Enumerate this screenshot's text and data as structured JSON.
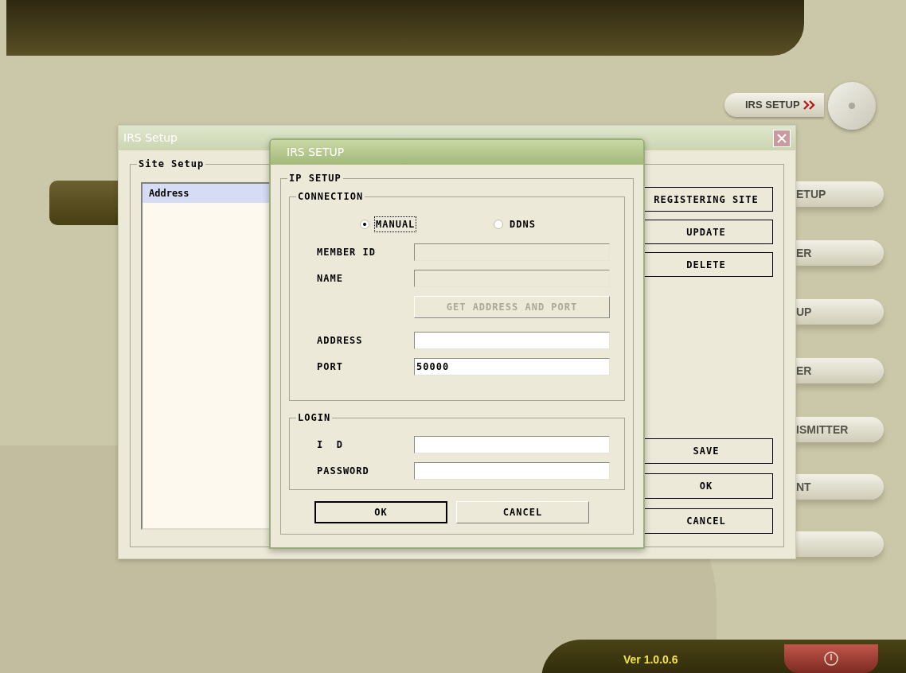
{
  "app": {
    "top_button": {
      "label": "IRS SETUP"
    },
    "side_menu": [
      {
        "label": "ETUP"
      },
      {
        "label": "ER"
      },
      {
        "label": "UP"
      },
      {
        "label": "ER"
      },
      {
        "label": "ISMITTER"
      },
      {
        "label": "NT"
      }
    ],
    "version": "Ver 1.0.0.6"
  },
  "site_dialog": {
    "title": "IRS Setup",
    "group": "Site Setup",
    "list": [
      {
        "label": "Address",
        "selected": true
      }
    ],
    "top_buttons": [
      {
        "label": "REGISTERING SITE"
      },
      {
        "label": "UPDATE"
      },
      {
        "label": "DELETE"
      }
    ],
    "bottom_buttons": [
      {
        "label": "SAVE"
      },
      {
        "label": "OK"
      },
      {
        "label": "CANCEL"
      }
    ]
  },
  "irs_dialog": {
    "title": "IRS SETUP",
    "group": "IP SETUP",
    "connection": {
      "title": "CONNECTION",
      "modes": [
        {
          "label": "MANUAL",
          "selected": true,
          "focused": true
        },
        {
          "label": "DDNS",
          "selected": false,
          "focused": false
        }
      ],
      "rows": [
        {
          "kind": "field",
          "label": "MEMBER ID",
          "disabled": true
        },
        {
          "kind": "field",
          "label": "NAME",
          "disabled": true
        },
        {
          "kind": "button",
          "label": "GET ADDRESS AND PORT",
          "disabled": true
        },
        {
          "kind": "field",
          "label": "ADDRESS",
          "disabled": false
        },
        {
          "kind": "field",
          "label": "PORT",
          "value": "50000",
          "disabled": false
        }
      ]
    },
    "login": {
      "title": "LOGIN",
      "rows": [
        {
          "kind": "field",
          "label": "I  D",
          "disabled": false
        },
        {
          "kind": "field",
          "label": "PASSWORD",
          "disabled": false
        }
      ]
    },
    "buttons": [
      {
        "label": "OK",
        "default": true
      },
      {
        "label": "CANCEL",
        "default": false
      }
    ]
  }
}
